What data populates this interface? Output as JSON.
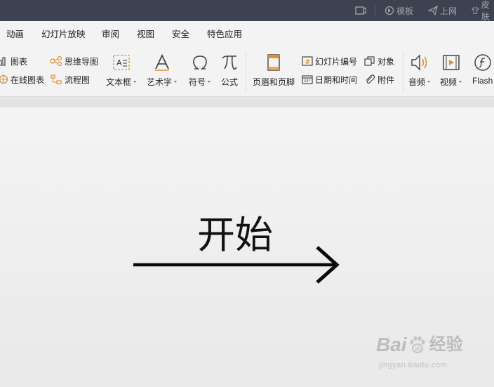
{
  "titlebar": {
    "template_label": "模板",
    "upload_label": "上网",
    "skin_label": "皮肤"
  },
  "menu": {
    "tabs": [
      "动画",
      "幻灯片放映",
      "审阅",
      "视图",
      "安全",
      "特色应用"
    ]
  },
  "ribbon": {
    "chart": "图表",
    "online_chart": "在线图表",
    "mindmap": "思维导图",
    "flowchart": "流程图",
    "textbox": "文本框",
    "wordart": "艺术字",
    "symbol": "符号",
    "formula": "公式",
    "header_footer": "页眉和页脚",
    "slide_number": "幻灯片编号",
    "date_time": "日期和时间",
    "object": "对象",
    "attachment": "附件",
    "audio": "音频",
    "video": "视频",
    "flash": "Flash"
  },
  "slide": {
    "text": "开始"
  },
  "watermark": {
    "brand_a": "Bai",
    "brand_b": "du",
    "brand_c": "经验",
    "url": "jingyan.baidu.com"
  },
  "colors": {
    "titlebar_bg": "#3d4251",
    "accent": "#e0912f"
  }
}
